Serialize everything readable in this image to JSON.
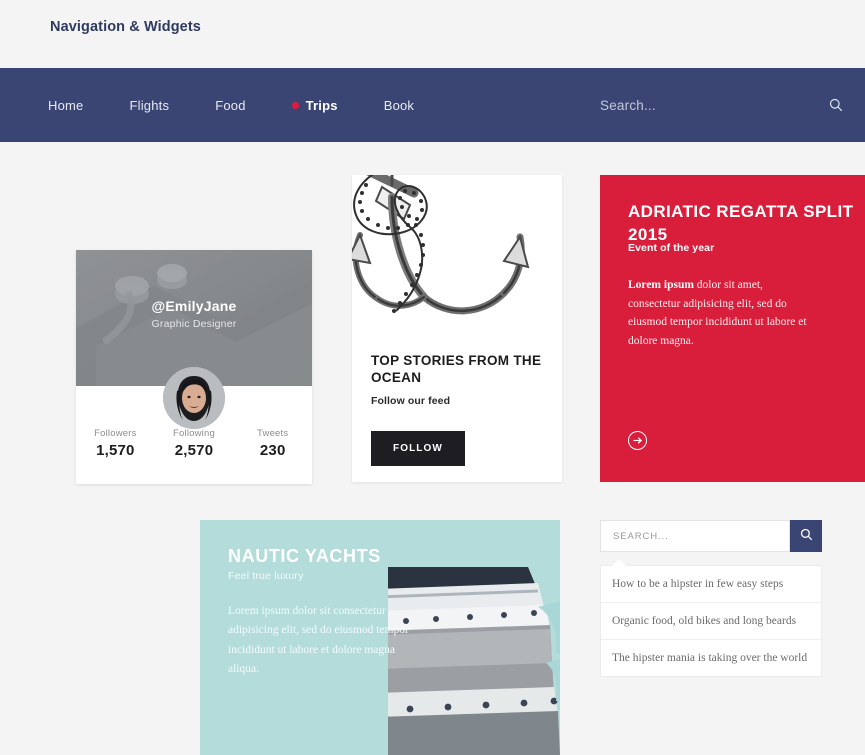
{
  "page": {
    "heading": "Navigation & Widgets",
    "background_color": "#f4f4f4"
  },
  "navbar": {
    "background_color": "#3a4574",
    "active_dot_color": "#e21b3c",
    "items": [
      {
        "label": "Home",
        "active": false
      },
      {
        "label": "Flights",
        "active": false
      },
      {
        "label": "Food",
        "active": false
      },
      {
        "label": "Trips",
        "active": true
      },
      {
        "label": "Book",
        "active": false
      }
    ],
    "search": {
      "placeholder": "Search...",
      "icon": "search-icon"
    }
  },
  "profile_card": {
    "handle": "@EmilyJane",
    "role": "Graphic Designer",
    "avatar_alt": "avatar",
    "stats": [
      {
        "label": "Followers",
        "value": "1,570"
      },
      {
        "label": "Following",
        "value": "2,570"
      },
      {
        "label": "Tweets",
        "value": "230"
      }
    ]
  },
  "stories_card": {
    "illustration": "anchor-illustration",
    "title": "TOP STORIES FROM THE OCEAN",
    "subtitle": "Follow our feed",
    "button_label": "FOLLOW"
  },
  "regatta_card": {
    "background_color": "#d91e3c",
    "title": "ADRIATIC REGATTA SPLIT 2015",
    "subtitle": "Event of the year",
    "body_lead": "Lorem ipsum",
    "body_rest": " dolor sit amet, consectetur adipisicing elit, sed do eiusmod tempor incididunt ut labore et dolore magna.",
    "arrow_icon": "arrow-right-circle-icon"
  },
  "yachts_card": {
    "background_color": "#b3dcdb",
    "title": "NAUTIC YACHTS",
    "subtitle": "Feel true luxury",
    "body": "Lorem ipsum dolor sit consectetur adipisicing elit, sed do eiusmod tempor incididunt ut labore et dolore magna aliqua.",
    "photo_alt": "yacht-photo"
  },
  "search_widget": {
    "input_value": "",
    "placeholder": "SEARCH...",
    "button_icon": "search-icon",
    "button_color": "#3a4574",
    "suggestions": [
      "How to be a hipster in few easy steps",
      "Organic food, old bikes and long beards",
      "The hipster mania is taking over the world"
    ]
  }
}
